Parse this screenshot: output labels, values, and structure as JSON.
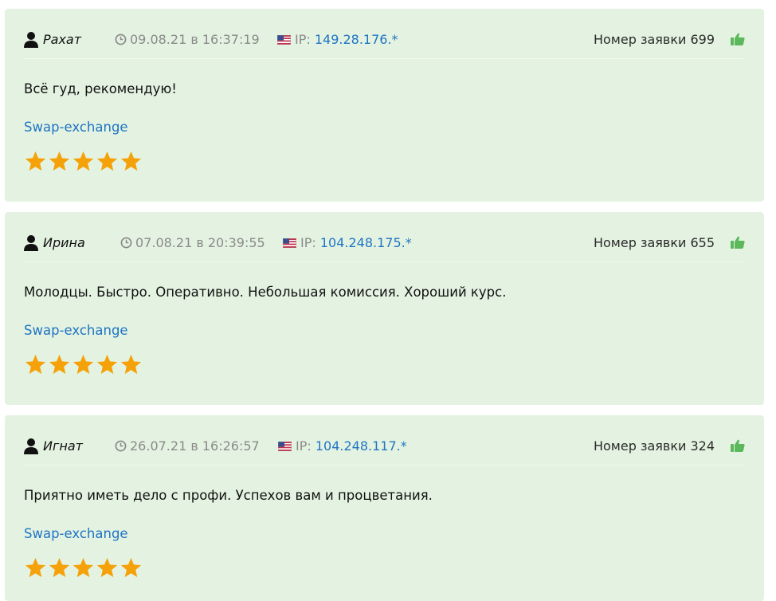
{
  "reviews": [
    {
      "name": "Рахат",
      "date": "09.08.21 в 16:37:19",
      "ip_label": "IP:",
      "ip": "149.28.176.*",
      "order": "Номер заявки 699",
      "text": "Всё гуд, рекомендую!",
      "site": "Swap-exchange",
      "rating": 5
    },
    {
      "name": "Ирина",
      "date": "07.08.21 в 20:39:55",
      "ip_label": "IP:",
      "ip": "104.248.175.*",
      "order": "Номер заявки 655",
      "text": "Молодцы. Быстро. Оперативно. Небольшая комиссия. Хороший курс.",
      "site": "Swap-exchange",
      "rating": 5
    },
    {
      "name": "Игнат",
      "date": "26.07.21 в 16:26:57",
      "ip_label": "IP:",
      "ip": "104.248.117.*",
      "order": "Номер заявки 324",
      "text": "Приятно иметь дело с профи. Успехов вам и процветания.",
      "site": "Swap-exchange",
      "rating": 5
    }
  ],
  "icons": {
    "user": "user-icon",
    "clock": "clock-icon",
    "flag": "us-flag-icon",
    "like": "thumbs-up-icon",
    "star": "star-icon"
  },
  "colors": {
    "card_bg": "#e4f3e1",
    "link": "#1f74c4",
    "star": "#f5a20a",
    "like": "#5cb85c",
    "muted": "#8a8a8a"
  }
}
